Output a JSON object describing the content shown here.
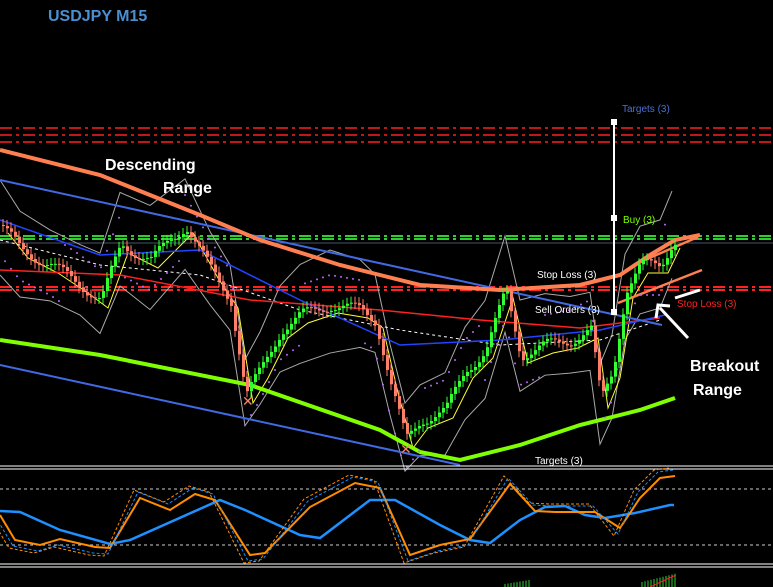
{
  "chart_data": {
    "type": "line",
    "title": "USDJPY M15",
    "symbol": "USDJPY",
    "timeframe": "M15",
    "annotations": {
      "descending_range": [
        "Descending",
        "Range"
      ],
      "breakout_range": [
        "Breakout",
        "Range"
      ]
    },
    "labels": {
      "targets_top": "Targets (3)",
      "buy": "Buy (3)",
      "stop_loss_left": "Stop Loss (3)",
      "stop_loss_right": "Stop Loss (3)",
      "sell_orders": "Sell Orders (3)",
      "targets_bottom": "Targets (3)"
    },
    "series": [
      {
        "name": "price-candles",
        "color_up": "#33ff33",
        "color_down": "#ff7f6a"
      },
      {
        "name": "slow-ma",
        "color": "#ff7f50"
      },
      {
        "name": "long-ma",
        "color": "#7fff00"
      },
      {
        "name": "descending-channel",
        "color": "#4169e1"
      },
      {
        "name": "oscillator-fast",
        "color": "#ff8c00"
      },
      {
        "name": "oscillator-slow",
        "color": "#1e90ff"
      }
    ],
    "grid": false
  }
}
